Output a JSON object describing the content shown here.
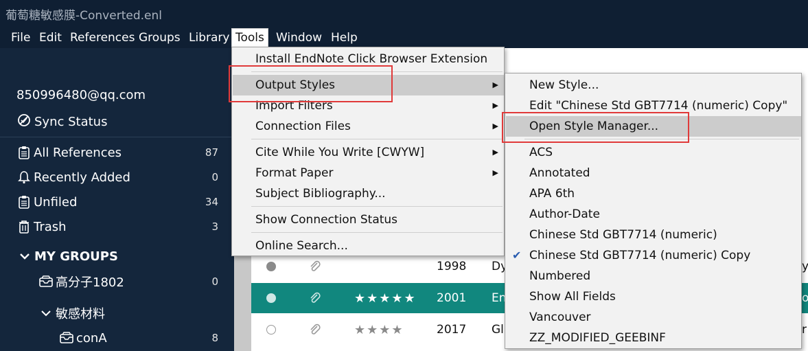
{
  "window": {
    "title": "葡萄糖敏感膜-Converted.enl"
  },
  "menubar": {
    "items": [
      {
        "label": "File",
        "active": false
      },
      {
        "label": "Edit",
        "active": false
      },
      {
        "label": "References",
        "active": false
      },
      {
        "label": "Groups",
        "active": false
      },
      {
        "label": "Library",
        "active": false
      },
      {
        "label": "Tools",
        "active": true
      },
      {
        "label": "Window",
        "active": false
      },
      {
        "label": "Help",
        "active": false
      }
    ]
  },
  "sidebar": {
    "account": "850996480@qq.com",
    "sync_status": "Sync Status",
    "items": [
      {
        "label": "All References",
        "count": "87",
        "icon": "clipboard-icon"
      },
      {
        "label": "Recently Added",
        "count": "0",
        "icon": "bell-icon"
      },
      {
        "label": "Unfiled",
        "count": "34",
        "icon": "clipboard-icon"
      },
      {
        "label": "Trash",
        "count": "3",
        "icon": "trash-icon"
      }
    ],
    "my_groups": "MY GROUPS",
    "groups": [
      {
        "label": "高分子1802",
        "count": "0",
        "icon": "group-icon"
      },
      {
        "label": "敏感材料",
        "count": "",
        "icon": "chevron-down-icon"
      },
      {
        "label": "conA",
        "count": "8",
        "icon": "group-icon"
      }
    ]
  },
  "references": {
    "rows": [
      {
        "year": "1998",
        "author": "Dy",
        "stars": "",
        "right": "y",
        "selected": false
      },
      {
        "year": "2001",
        "author": "En",
        "stars": "★★★★★",
        "right": "o",
        "selected": true
      },
      {
        "year": "2017",
        "author": "Gl",
        "stars": "★★★★",
        "right": "r",
        "selected": false
      }
    ]
  },
  "tools_menu": {
    "items": [
      {
        "label": "Install EndNote Click Browser Extension",
        "submenu": false
      },
      {
        "label": "Output Styles",
        "submenu": true,
        "highlighted": true
      },
      {
        "label": "Import Filters",
        "submenu": true
      },
      {
        "label": "Connection Files",
        "submenu": true
      },
      {
        "label": "Cite While You Write [CWYW]",
        "submenu": true
      },
      {
        "label": "Format Paper",
        "submenu": true
      },
      {
        "label": "Subject Bibliography...",
        "submenu": false
      },
      {
        "label": "Show Connection Status",
        "submenu": false
      },
      {
        "label": "Online Search...",
        "submenu": false
      }
    ]
  },
  "output_styles_menu": {
    "actions": [
      {
        "label": "New Style..."
      },
      {
        "label": "Edit \"Chinese Std GBT7714 (numeric) Copy\""
      },
      {
        "label": "Open Style Manager...",
        "highlighted": true
      }
    ],
    "styles": [
      {
        "label": "ACS",
        "checked": false
      },
      {
        "label": "Annotated",
        "checked": false
      },
      {
        "label": "APA 6th",
        "checked": false
      },
      {
        "label": "Author-Date",
        "checked": false
      },
      {
        "label": "Chinese Std GBT7714 (numeric)",
        "checked": false
      },
      {
        "label": "Chinese Std GBT7714 (numeric) Copy",
        "checked": true
      },
      {
        "label": "Numbered",
        "checked": false
      },
      {
        "label": "Show All Fields",
        "checked": false
      },
      {
        "label": "Vancouver",
        "checked": false
      },
      {
        "label": "ZZ_MODIFIED_GEEBINF",
        "checked": false
      }
    ]
  },
  "colors": {
    "sidebar_bg": "#14263c",
    "titlebar_bg": "#0f1f33",
    "selected_row": "#11877e",
    "highlight_box": "#e03a3a",
    "check_mark": "#2a5db0"
  }
}
